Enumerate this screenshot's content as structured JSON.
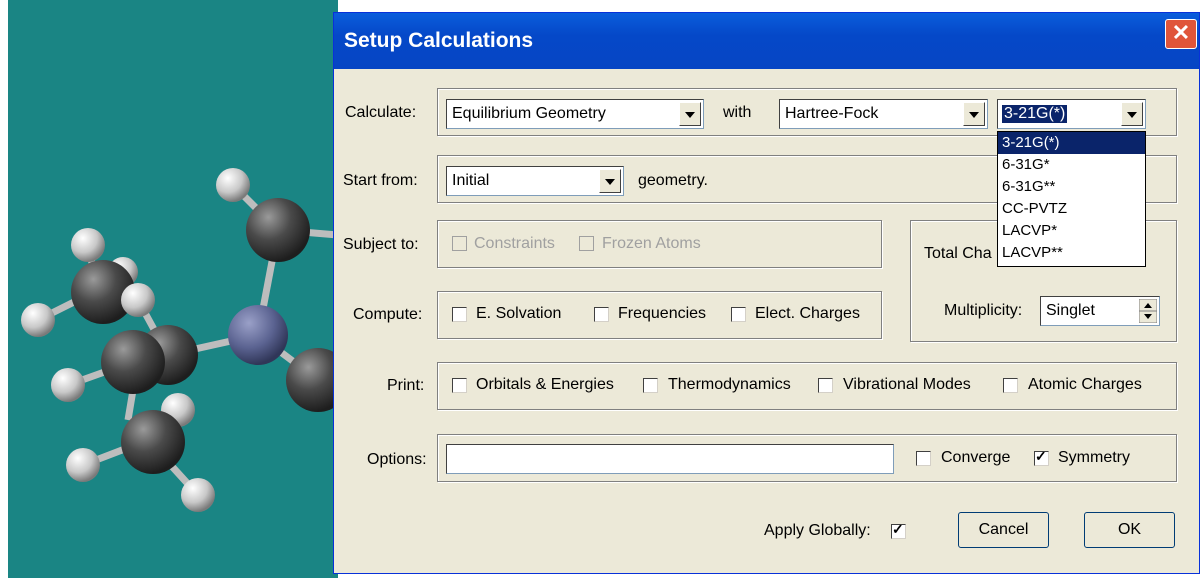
{
  "dialog": {
    "title": "Setup Calculations",
    "close_label": "✕"
  },
  "calculate": {
    "label": "Calculate:",
    "task": "Equilibrium Geometry",
    "with_label": "with",
    "method": "Hartree-Fock",
    "basis": "3-21G(*)"
  },
  "basis_options": [
    "3-21G(*)",
    "6-31G*",
    "6-31G**",
    "CC-PVTZ",
    "LACVP*",
    "LACVP**"
  ],
  "start": {
    "label": "Start from:",
    "value": "Initial",
    "suffix": "geometry."
  },
  "subject": {
    "label": "Subject to:",
    "constraints": "Constraints",
    "frozen": "Frozen Atoms"
  },
  "compute": {
    "label": "Compute:",
    "solvation": "E. Solvation",
    "frequencies": "Frequencies",
    "charges": "Elect. Charges"
  },
  "charge": {
    "label": "Total Cha",
    "multiplicity_label": "Multiplicity:",
    "multiplicity": "Singlet"
  },
  "print": {
    "label": "Print:",
    "orbitals": "Orbitals & Energies",
    "thermo": "Thermodynamics",
    "vib": "Vibrational Modes",
    "atomic": "Atomic Charges"
  },
  "options": {
    "label": "Options:",
    "value": "",
    "converge": "Converge",
    "symmetry": "Symmetry",
    "symmetry_checked": true
  },
  "footer": {
    "apply_label": "Apply Globally:",
    "apply_checked": true,
    "cancel": "Cancel",
    "ok": "OK"
  },
  "colors": {
    "viewport_bg": "#1a8584",
    "title_bar": "#0548c8",
    "selection": "#0a246a"
  }
}
